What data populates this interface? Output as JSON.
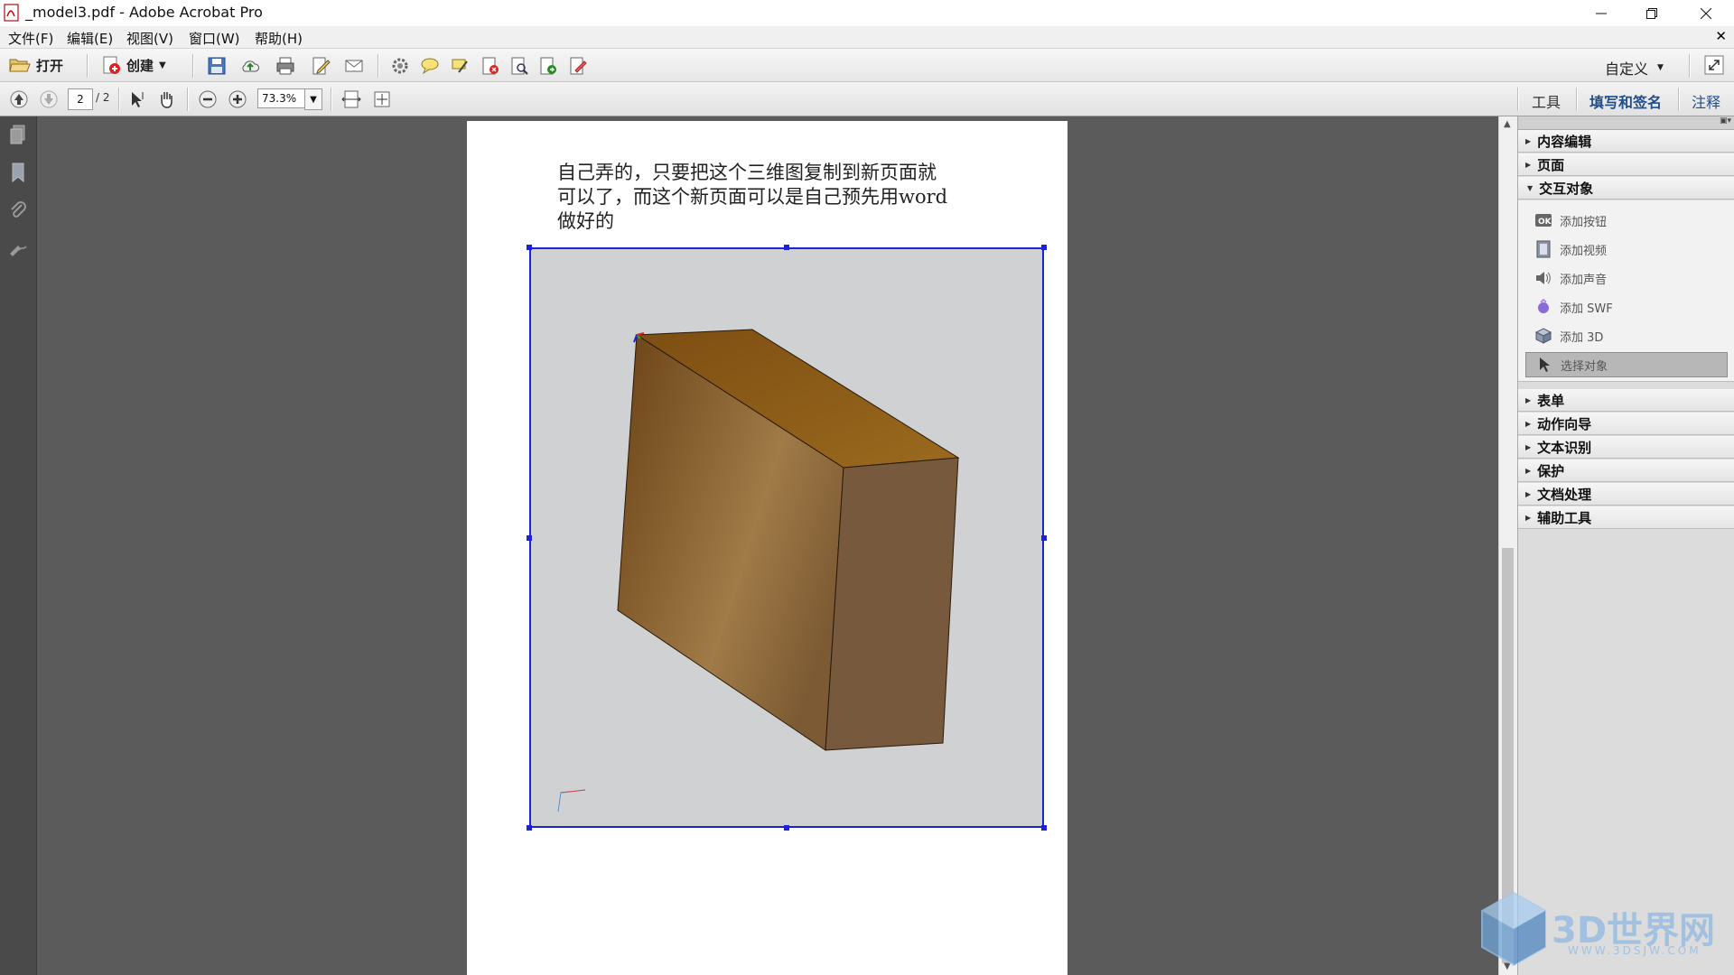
{
  "window": {
    "title": "_model3.pdf - Adobe Acrobat Pro"
  },
  "menu": [
    "文件(F)",
    "编辑(E)",
    "视图(V)",
    "窗口(W)",
    "帮助(H)"
  ],
  "toolbar": {
    "open_label": "打开",
    "create_label": "创建",
    "customize_label": "自定义"
  },
  "nav": {
    "current_page": "2",
    "total_pages": "/ 2",
    "zoom": "73.3%"
  },
  "right_tabs": [
    "工具",
    "填写和签名",
    "注释"
  ],
  "document": {
    "text_lines": [
      "自己弄的，只要把这个三维图复制到新页面就",
      "可以了，而这个新页面可以是自己预先用word",
      "做好的"
    ]
  },
  "panel": {
    "sections_top": [
      "内容编辑",
      "页面"
    ],
    "expanded_section": "交互对象",
    "expanded_items": [
      {
        "label": "添加按钮",
        "icon": "ok-button-icon"
      },
      {
        "label": "添加视频",
        "icon": "film-icon"
      },
      {
        "label": "添加声音",
        "icon": "speaker-icon"
      },
      {
        "label": "添加 SWF",
        "icon": "swf-icon"
      },
      {
        "label": "添加 3D",
        "icon": "cube-icon"
      },
      {
        "label": "选择对象",
        "icon": "cursor-icon"
      }
    ],
    "sections_bottom": [
      "表单",
      "动作向导",
      "文本识别",
      "保护",
      "文档处理",
      "辅助工具"
    ]
  },
  "watermark": {
    "brand": "3D世界网",
    "url": "WWW.3DSJW.COM"
  },
  "colors": {
    "selection_blue": "#1a23d8",
    "box_top": "#8b5a17",
    "box_front": "#8a6232",
    "box_side": "#765b40"
  }
}
